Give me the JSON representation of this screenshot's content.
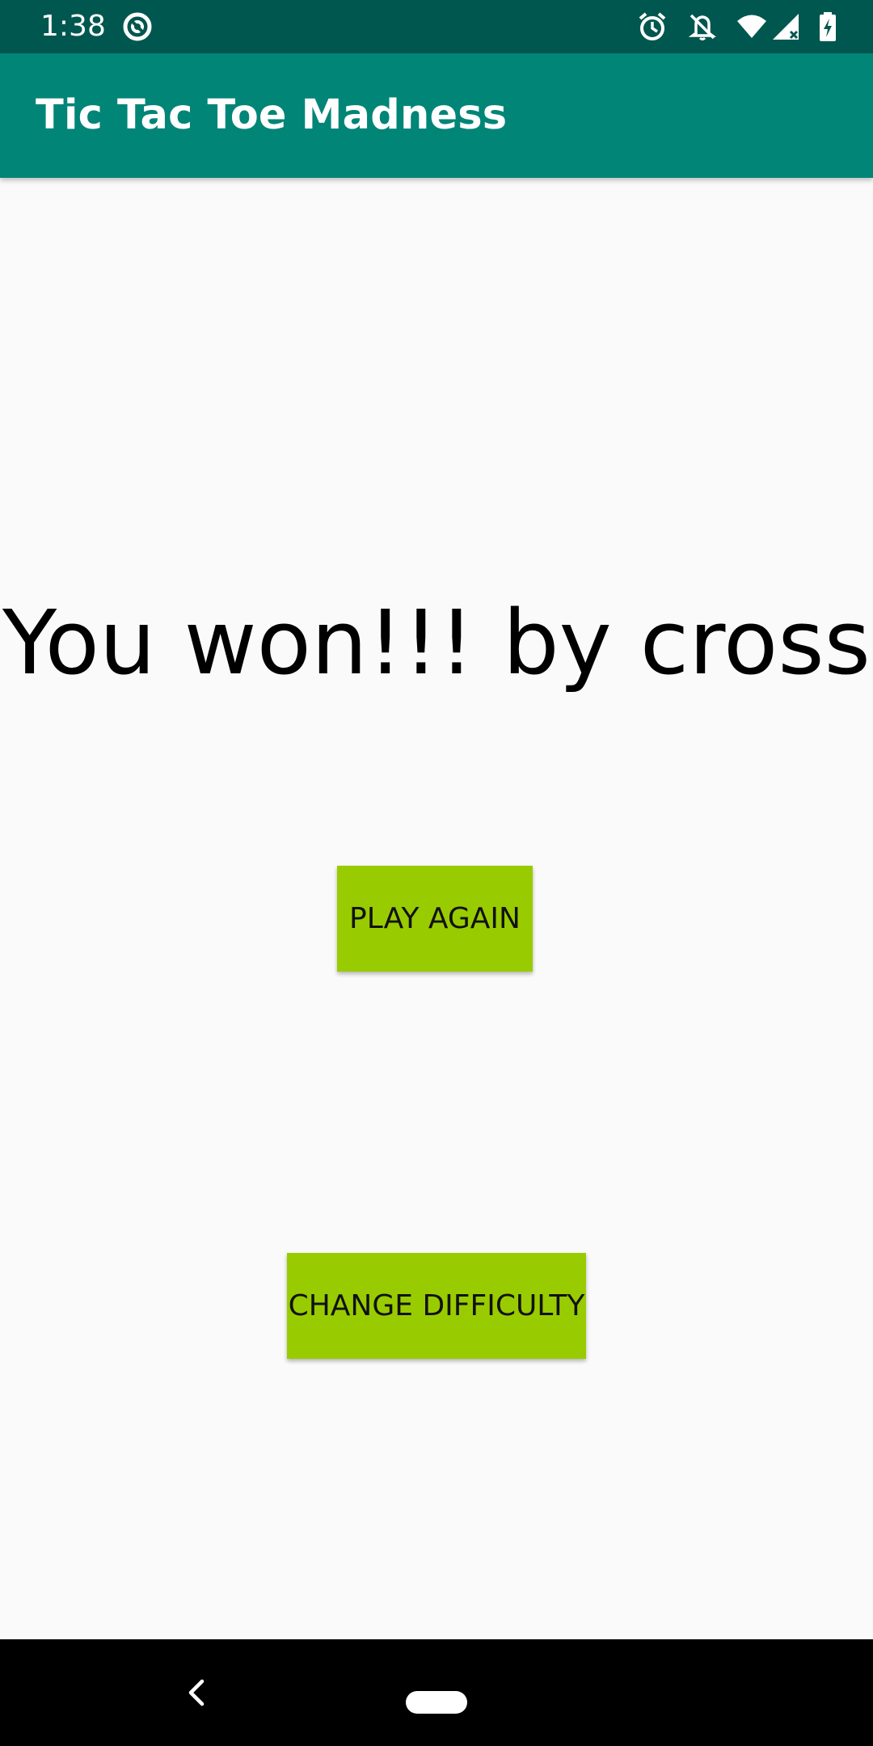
{
  "status_bar": {
    "time": "1:38",
    "icons": [
      "sync-icon",
      "alarm-icon",
      "notifications-off-icon",
      "wifi-icon",
      "signal-icon",
      "battery-charging-icon"
    ]
  },
  "app_bar": {
    "title": "Tic Tac Toe Madness"
  },
  "main": {
    "result_message": "You won!!! by cross",
    "play_again_label": "PLAY AGAIN",
    "change_difficulty_label": "CHANGE DIFFICULTY"
  },
  "nav_bar": {
    "icons": [
      "back-icon",
      "home-pill-icon"
    ]
  },
  "colors": {
    "status_bar": "#00574f",
    "app_bar": "#008577",
    "button": "#99cc00",
    "background": "#fafafa"
  }
}
